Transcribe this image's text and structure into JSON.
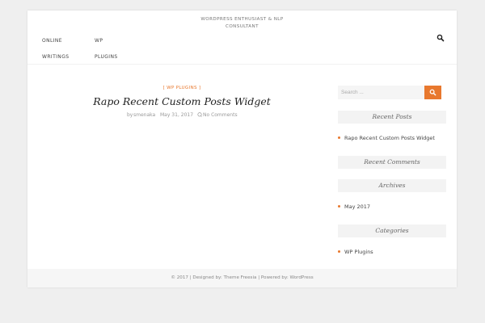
{
  "header": {
    "tagline_line1": "WORDPRESS ENTHUSIAST & NLP",
    "tagline_line2": "CONSULTANT",
    "search_icon": "search-icon"
  },
  "nav": {
    "items": [
      "ONLINE",
      "WP",
      "WRITINGS",
      "PLUGINS"
    ]
  },
  "post": {
    "category": "[ WP PLUGINS ]",
    "title": "Rapo Recent Custom Posts Widget",
    "by_label": "by",
    "author": "smenaka",
    "date": "May 31, 2017",
    "comments": "No Comments",
    "comment_icon": "comment-icon"
  },
  "sidebar": {
    "search_placeholder": "Search ...",
    "widgets": [
      {
        "title": "Recent Posts",
        "items": [
          "Rapo Recent Custom Posts Widget"
        ]
      },
      {
        "title": "Recent Comments",
        "items": []
      },
      {
        "title": "Archives",
        "items": [
          "May 2017"
        ]
      },
      {
        "title": "Categories",
        "items": [
          "WP Plugins"
        ]
      }
    ]
  },
  "footer": {
    "text": "© 2017 | Designed by: Theme Freesia | Powered by: WordPress"
  },
  "colors": {
    "accent": "#e8782e",
    "page_background": "#efefef",
    "widget_background": "#f3f3f3"
  }
}
